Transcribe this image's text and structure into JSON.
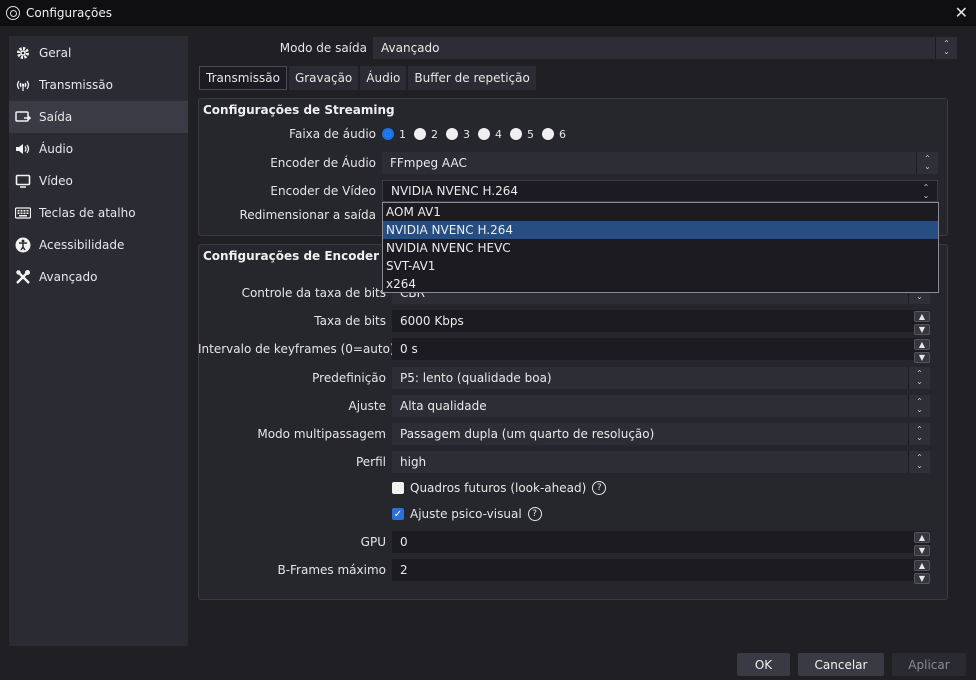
{
  "window": {
    "title": "Configurações",
    "close": "✕"
  },
  "sidebar": {
    "items": [
      {
        "label": "Geral",
        "icon": "gear-icon"
      },
      {
        "label": "Transmissão",
        "icon": "antenna-icon"
      },
      {
        "label": "Saída",
        "icon": "output-icon",
        "active": true
      },
      {
        "label": "Áudio",
        "icon": "speaker-icon"
      },
      {
        "label": "Vídeo",
        "icon": "monitor-icon"
      },
      {
        "label": "Teclas de atalho",
        "icon": "keyboard-icon"
      },
      {
        "label": "Acessibilidade",
        "icon": "accessibility-icon"
      },
      {
        "label": "Avançado",
        "icon": "tools-icon"
      }
    ]
  },
  "output_mode": {
    "label": "Modo de saída",
    "value": "Avançado"
  },
  "tabs": [
    "Transmissão",
    "Gravação",
    "Áudio",
    "Buffer de repetição"
  ],
  "streaming": {
    "title": "Configurações de Streaming",
    "audio_track_label": "Faixa de áudio",
    "audio_tracks": [
      "1",
      "2",
      "3",
      "4",
      "5",
      "6"
    ],
    "selected_track": "1",
    "audio_encoder_label": "Encoder de Áudio",
    "audio_encoder_value": "FFmpeg AAC",
    "video_encoder_label": "Encoder de Vídeo",
    "video_encoder_value": "NVIDIA NVENC H.264",
    "rescale_label": "Redimensionar a saída",
    "encoder_options": [
      "AOM AV1",
      "NVIDIA NVENC H.264",
      "NVIDIA NVENC HEVC",
      "SVT-AV1",
      "x264"
    ],
    "selected_encoder_index": 1
  },
  "encoder": {
    "title": "Configurações de Encoder",
    "rate_control_label": "Controle da taxa de bits",
    "rate_control_value": "CBR",
    "bitrate_label": "Taxa de bits",
    "bitrate_value": "6000 Kbps",
    "keyframe_label": "Intervalo de keyframes (0=auto)",
    "keyframe_value": "0 s",
    "preset_label": "Predefinição",
    "preset_value": "P5: lento (qualidade boa)",
    "tuning_label": "Ajuste",
    "tuning_value": "Alta qualidade",
    "multipass_label": "Modo multipassagem",
    "multipass_value": "Passagem dupla (um quarto de resolução)",
    "profile_label": "Perfil",
    "profile_value": "high",
    "lookahead_label": "Quadros futuros (look-ahead)",
    "lookahead_checked": false,
    "psycho_label": "Ajuste psico-visual",
    "psycho_checked": true,
    "gpu_label": "GPU",
    "gpu_value": "0",
    "bframes_label": "B-Frames máximo",
    "bframes_value": "2"
  },
  "footer": {
    "ok": "OK",
    "cancel": "Cancelar",
    "apply": "Aplicar"
  },
  "colors": {
    "accent": "#1a73e8",
    "selection": "#264e82",
    "background": "#1f1f24"
  }
}
